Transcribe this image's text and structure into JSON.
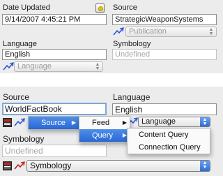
{
  "top": {
    "date_updated_label": "Date Updated",
    "date_updated_value": "9/14/2007 4:45:21 PM",
    "calendar_icon": "calendar-icon",
    "source_label": "Source",
    "source_value": "StrategicWeaponSystems",
    "source_type_select": "Publication",
    "language_label": "Language",
    "language_value": "English",
    "language_select": "Language",
    "symbology_label": "Symbology",
    "symbology_value": "Undefined"
  },
  "bottom": {
    "source_label": "Source",
    "source_value": "WorldFactBook",
    "language_label": "Language",
    "language_value": "English",
    "language_select": "Language",
    "symbology_label": "Symbology",
    "symbology_value": "Undefined",
    "symbology_select": "Symbology"
  },
  "context_menu": {
    "level1": [
      "Source"
    ],
    "level2": [
      "Feed",
      "Query"
    ],
    "level3": [
      "Content Query",
      "Connection Query"
    ]
  },
  "colors": {
    "highlight": "#2968d4",
    "link_blue": "#2a55d8",
    "link_red": "#c02020"
  }
}
